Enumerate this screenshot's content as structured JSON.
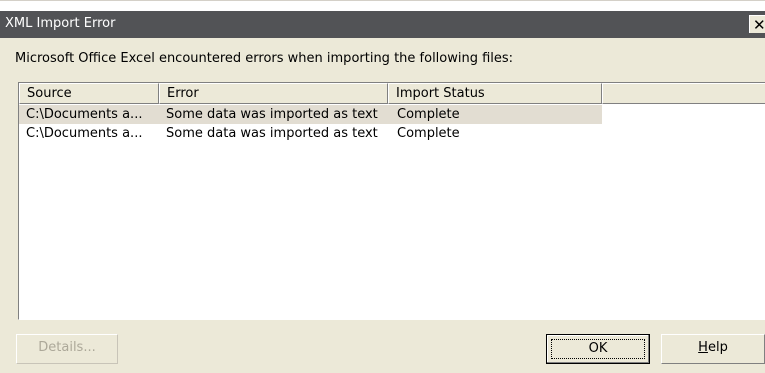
{
  "window": {
    "title": "XML Import Error",
    "close_glyph": "✕"
  },
  "message": "Microsoft Office Excel encountered errors when importing the following files:",
  "list": {
    "columns": [
      "Source",
      "Error",
      "Import Status",
      ""
    ],
    "rows": [
      {
        "source": "C:\\Documents a...",
        "error": "Some data was imported as text",
        "status": "Complete"
      },
      {
        "source": "C:\\Documents a...",
        "error": "Some data was imported as text",
        "status": "Complete"
      }
    ],
    "selected_row": 0
  },
  "buttons": {
    "details": "Details...",
    "ok": "OK",
    "help": "Help"
  },
  "colors": {
    "titlebar": "#525356",
    "face": "#ece9d8",
    "selection": "#e2ddd2",
    "disabled_text": "#aca899"
  }
}
